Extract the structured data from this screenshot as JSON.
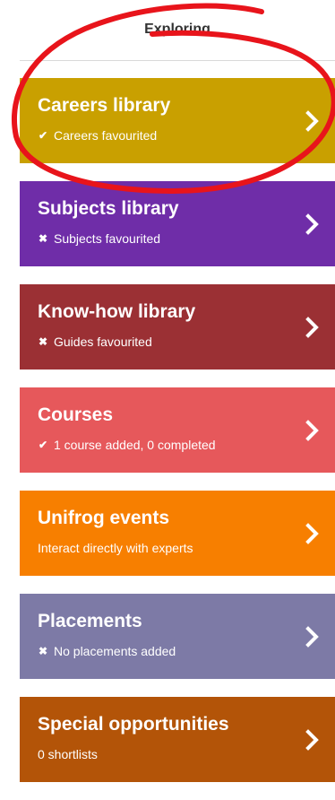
{
  "header": {
    "title": "Exploring"
  },
  "tiles": [
    {
      "title": "Careers library",
      "status": "Careers favourited",
      "status_icon": "check-icon",
      "color": "#c9a000"
    },
    {
      "title": "Subjects library",
      "status": "Subjects favourited",
      "status_icon": "cross-icon",
      "color": "#6f2da8"
    },
    {
      "title": "Know-how library",
      "status": "Guides favourited",
      "status_icon": "cross-icon",
      "color": "#9b3034"
    },
    {
      "title": "Courses",
      "status": "1 course added, 0 completed",
      "status_icon": "check-icon",
      "color": "#e6585b"
    },
    {
      "title": "Unifrog events",
      "status": "Interact directly with experts",
      "status_icon": "",
      "color": "#f77f00"
    },
    {
      "title": "Placements",
      "status": "No placements added",
      "status_icon": "cross-icon",
      "color": "#7d7aa6"
    },
    {
      "title": "Special opportunities",
      "status": "0 shortlists",
      "status_icon": "",
      "color": "#b35408"
    }
  ],
  "annotation": {
    "color": "#e8141b"
  }
}
